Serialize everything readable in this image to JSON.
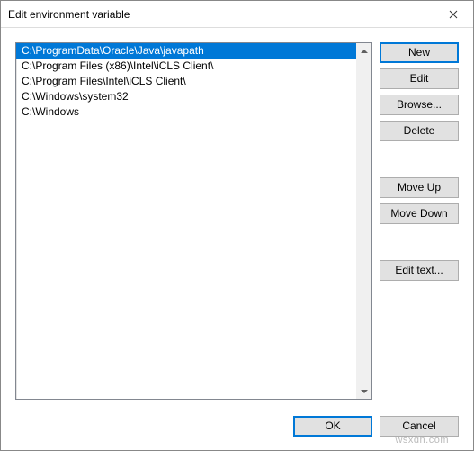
{
  "window": {
    "title": "Edit environment variable"
  },
  "list": {
    "items": [
      "C:\\ProgramData\\Oracle\\Java\\javapath",
      "C:\\Program Files (x86)\\Intel\\iCLS Client\\",
      "C:\\Program Files\\Intel\\iCLS Client\\",
      "C:\\Windows\\system32",
      "C:\\Windows"
    ],
    "selected_index": 0
  },
  "buttons": {
    "new": "New",
    "edit": "Edit",
    "browse": "Browse...",
    "delete": "Delete",
    "move_up": "Move Up",
    "move_down": "Move Down",
    "edit_text": "Edit text...",
    "ok": "OK",
    "cancel": "Cancel"
  },
  "watermark": "wsxdn.com"
}
